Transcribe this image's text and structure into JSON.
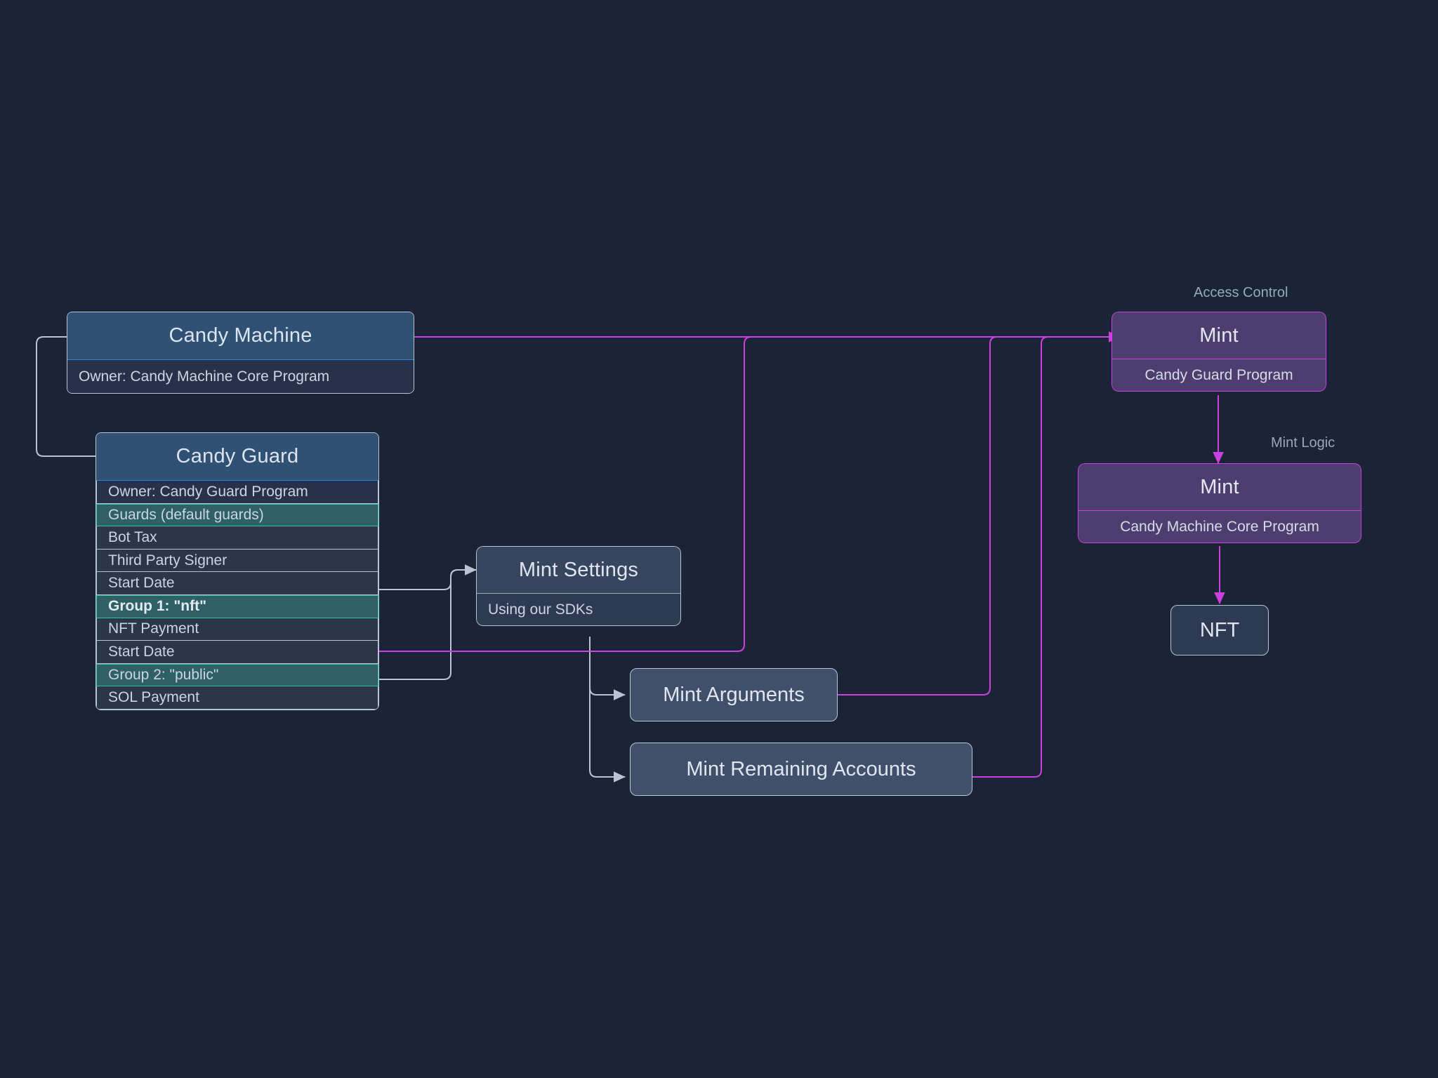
{
  "diagram": {
    "background": "#1b2436",
    "accent_blue": "#2f82d6",
    "accent_teal": "#37c2a4",
    "accent_magenta": "#cc3fe0",
    "edge_gray": "#b9c3d1"
  },
  "nodes": {
    "candy_machine": {
      "title": "Candy Machine",
      "subtitle": "Owner: Candy Machine Core Program"
    },
    "candy_guard": {
      "title": "Candy Guard",
      "rows": [
        {
          "label": "Owner: Candy Guard Program",
          "kind": "owner"
        },
        {
          "label": "Guards (default guards)",
          "kind": "group"
        },
        {
          "label": "Bot Tax",
          "kind": "plain"
        },
        {
          "label": "Third Party Signer",
          "kind": "plain"
        },
        {
          "label": "Start Date",
          "kind": "plain"
        },
        {
          "label": "Group 1: \"nft\"",
          "kind": "group-bold"
        },
        {
          "label": "NFT Payment",
          "kind": "plain"
        },
        {
          "label": "Start Date",
          "kind": "plain"
        },
        {
          "label": "Group 2: \"public\"",
          "kind": "group"
        },
        {
          "label": "SOL Payment",
          "kind": "plain"
        }
      ]
    },
    "mint_settings": {
      "title": "Mint Settings",
      "subtitle": "Using our SDKs"
    },
    "mint_arguments": {
      "title": "Mint Arguments"
    },
    "mint_remaining_accounts": {
      "title": "Mint Remaining Accounts"
    },
    "mint_access_control": {
      "title": "Mint",
      "subtitle": "Candy Guard Program"
    },
    "mint_logic": {
      "title": "Mint",
      "subtitle": "Candy Machine Core Program"
    },
    "nft": {
      "title": "NFT"
    }
  },
  "edge_labels": {
    "access_control": "Access Control",
    "mint_logic": "Mint Logic"
  }
}
